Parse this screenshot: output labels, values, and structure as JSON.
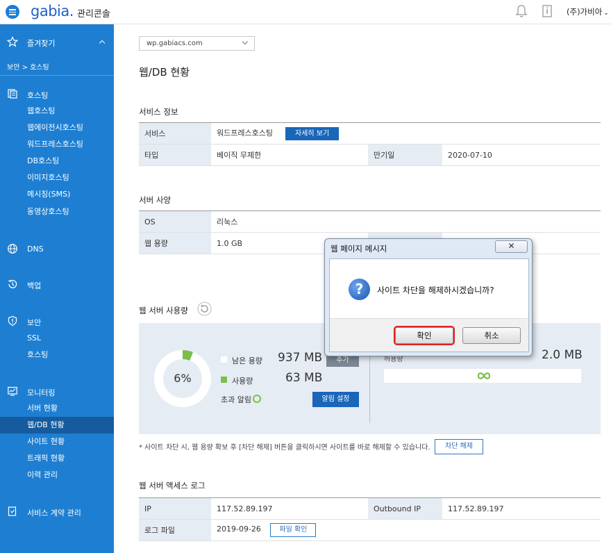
{
  "header": {
    "logo": "gabia.",
    "subtitle": "관리콘솔",
    "user": "(주)가비아"
  },
  "sidebar": {
    "favorites": "즐겨찾기",
    "breadcrumb": "보안 > 호스팅",
    "hosting": {
      "label": "호스팅",
      "items": [
        "웹호스팅",
        "웹에이전시호스팅",
        "워드프레스호스팅",
        "DB호스팅",
        "이미지호스팅",
        "메시징(SMS)",
        "동영상호스팅"
      ]
    },
    "dns": "DNS",
    "backup": "백업",
    "security": {
      "label": "보안",
      "items": [
        "SSL",
        "호스팅"
      ]
    },
    "monitoring": {
      "label": "모니터링",
      "items": [
        "서버 현황",
        "웹/DB 현황",
        "사이트 현황",
        "트래픽 현황",
        "이력 관리"
      ]
    },
    "contract": "서비스 계약 관리"
  },
  "main": {
    "domain": "wp.gabiacs.com",
    "page_title": "웹/DB 현황",
    "service_info": {
      "title": "서비스 정보",
      "service_label": "서비스",
      "service_value": "워드프레스호스팅",
      "detail_button": "자세히 보기",
      "type_label": "타입",
      "type_value": "베이직 무제한",
      "expiry_label": "만기일",
      "expiry_value": "2020-07-10"
    },
    "server_spec": {
      "title": "서버 사양",
      "os_label": "OS",
      "os_value": "리눅스",
      "web_label": "웹 용량",
      "web_value": "1.0 GB"
    },
    "usage": {
      "title": "웹 서버 사용량",
      "percent": "6%",
      "percent_value": 6,
      "remaining_label": "남은 용량",
      "remaining_value": "937 MB",
      "add_button": "추가",
      "used_label": "사용량",
      "used_value": "63 MB",
      "alert_label": "초과 알림",
      "alert_button": "알림 설정",
      "right_label": "허용량",
      "right_value": "2.0 MB"
    },
    "notice": "* 사이트 차단 시, 웹 용량 확보 후 [차단 해제] 버튼을 클릭하시면 사이트를 바로 해제할 수 있습니다.",
    "unblock_button": "차단 해제",
    "access_log": {
      "title": "웹 서버 액세스 로그",
      "ip_label": "IP",
      "ip_value": "117.52.89.197",
      "outbound_label": "Outbound IP",
      "outbound_value": "117.52.89.197",
      "log_label": "로그 파일",
      "log_value": "2019-09-26",
      "log_button": "파일 확인"
    }
  },
  "dialog": {
    "title": "웹 페이지 메시지",
    "close": "✕",
    "message": "사이트 차단을 해제하시겠습니까?",
    "ok": "확인",
    "cancel": "취소"
  },
  "colors": {
    "sidebar": "#1e7fd2",
    "active": "#155b9e",
    "accent": "#1a66b8",
    "usage_green": "#7bbf4a"
  }
}
